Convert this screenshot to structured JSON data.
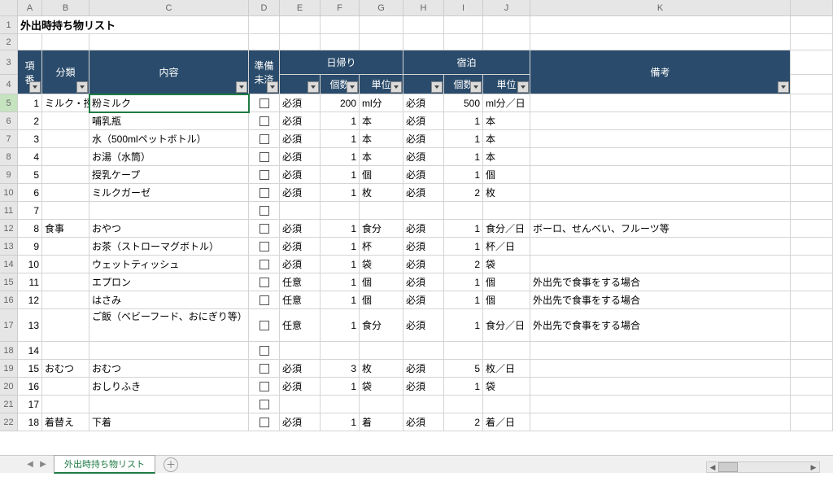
{
  "title": "外出時持ち物リスト",
  "columns": [
    "A",
    "B",
    "C",
    "D",
    "E",
    "F",
    "G",
    "H",
    "I",
    "J",
    "K"
  ],
  "headers": {
    "num": "項番",
    "cat": "分類",
    "content": "内容",
    "prep": "準備\n未済",
    "day": "日帰り",
    "stay": "宿泊",
    "qty": "個数",
    "unit": "単位",
    "note": "備考"
  },
  "sheet_tab": "外出時持ち物リスト",
  "chart_data": {
    "type": "table",
    "title": "外出時持ち物リスト",
    "columns": [
      "項番",
      "分類",
      "内容",
      "準備未済",
      "日帰り",
      "日帰り個数",
      "日帰り単位",
      "宿泊",
      "宿泊個数",
      "宿泊単位",
      "備考"
    ],
    "rows": [
      {
        "num": 1,
        "cat": "ミルク・授乳",
        "content": "粉ミルク",
        "prep": "□",
        "day": "必須",
        "day_qty": 200,
        "day_unit": "ml分",
        "stay": "必須",
        "stay_qty": 500,
        "stay_unit": "ml分／日",
        "note": ""
      },
      {
        "num": 2,
        "cat": "",
        "content": "哺乳瓶",
        "prep": "□",
        "day": "必須",
        "day_qty": 1,
        "day_unit": "本",
        "stay": "必須",
        "stay_qty": 1,
        "stay_unit": "本",
        "note": ""
      },
      {
        "num": 3,
        "cat": "",
        "content": "水（500mlペットボトル）",
        "prep": "□",
        "day": "必須",
        "day_qty": 1,
        "day_unit": "本",
        "stay": "必須",
        "stay_qty": 1,
        "stay_unit": "本",
        "note": ""
      },
      {
        "num": 4,
        "cat": "",
        "content": "お湯（水筒）",
        "prep": "□",
        "day": "必須",
        "day_qty": 1,
        "day_unit": "本",
        "stay": "必須",
        "stay_qty": 1,
        "stay_unit": "本",
        "note": ""
      },
      {
        "num": 5,
        "cat": "",
        "content": "授乳ケープ",
        "prep": "□",
        "day": "必須",
        "day_qty": 1,
        "day_unit": "個",
        "stay": "必須",
        "stay_qty": 1,
        "stay_unit": "個",
        "note": ""
      },
      {
        "num": 6,
        "cat": "",
        "content": "ミルクガーゼ",
        "prep": "□",
        "day": "必須",
        "day_qty": 1,
        "day_unit": "枚",
        "stay": "必須",
        "stay_qty": 2,
        "stay_unit": "枚",
        "note": ""
      },
      {
        "num": 7,
        "cat": "",
        "content": "",
        "prep": "□",
        "day": "",
        "day_qty": "",
        "day_unit": "",
        "stay": "",
        "stay_qty": "",
        "stay_unit": "",
        "note": ""
      },
      {
        "num": 8,
        "cat": "食事",
        "content": "おやつ",
        "prep": "□",
        "day": "必須",
        "day_qty": 1,
        "day_unit": "食分",
        "stay": "必須",
        "stay_qty": 1,
        "stay_unit": "食分／日",
        "note": "ボーロ、せんべい、フルーツ等"
      },
      {
        "num": 9,
        "cat": "",
        "content": "お茶（ストローマグボトル）",
        "prep": "□",
        "day": "必須",
        "day_qty": 1,
        "day_unit": "杯",
        "stay": "必須",
        "stay_qty": 1,
        "stay_unit": "杯／日",
        "note": ""
      },
      {
        "num": 10,
        "cat": "",
        "content": "ウェットティッシュ",
        "prep": "□",
        "day": "必須",
        "day_qty": 1,
        "day_unit": "袋",
        "stay": "必須",
        "stay_qty": 2,
        "stay_unit": "袋",
        "note": ""
      },
      {
        "num": 11,
        "cat": "",
        "content": "エプロン",
        "prep": "□",
        "day": "任意",
        "day_qty": 1,
        "day_unit": "個",
        "stay": "必須",
        "stay_qty": 1,
        "stay_unit": "個",
        "note": "外出先で食事をする場合"
      },
      {
        "num": 12,
        "cat": "",
        "content": "はさみ",
        "prep": "□",
        "day": "任意",
        "day_qty": 1,
        "day_unit": "個",
        "stay": "必須",
        "stay_qty": 1,
        "stay_unit": "個",
        "note": "外出先で食事をする場合"
      },
      {
        "num": 13,
        "cat": "",
        "content": "ご飯（ベビーフード、おにぎり等）",
        "prep": "□",
        "day": "任意",
        "day_qty": 1,
        "day_unit": "食分",
        "stay": "必須",
        "stay_qty": 1,
        "stay_unit": "食分／日",
        "note": "外出先で食事をする場合",
        "tall": true
      },
      {
        "num": 14,
        "cat": "",
        "content": "",
        "prep": "□",
        "day": "",
        "day_qty": "",
        "day_unit": "",
        "stay": "",
        "stay_qty": "",
        "stay_unit": "",
        "note": ""
      },
      {
        "num": 15,
        "cat": "おむつ",
        "content": "おむつ",
        "prep": "□",
        "day": "必須",
        "day_qty": 3,
        "day_unit": "枚",
        "stay": "必須",
        "stay_qty": 5,
        "stay_unit": "枚／日",
        "note": ""
      },
      {
        "num": 16,
        "cat": "",
        "content": "おしりふき",
        "prep": "□",
        "day": "必須",
        "day_qty": 1,
        "day_unit": "袋",
        "stay": "必須",
        "stay_qty": 1,
        "stay_unit": "袋",
        "note": ""
      },
      {
        "num": 17,
        "cat": "",
        "content": "",
        "prep": "□",
        "day": "",
        "day_qty": "",
        "day_unit": "",
        "stay": "",
        "stay_qty": "",
        "stay_unit": "",
        "note": ""
      },
      {
        "num": 18,
        "cat": "着替え",
        "content": "下着",
        "prep": "□",
        "day": "必須",
        "day_qty": 1,
        "day_unit": "着",
        "stay": "必須",
        "stay_qty": 2,
        "stay_unit": "着／日",
        "note": ""
      }
    ]
  }
}
